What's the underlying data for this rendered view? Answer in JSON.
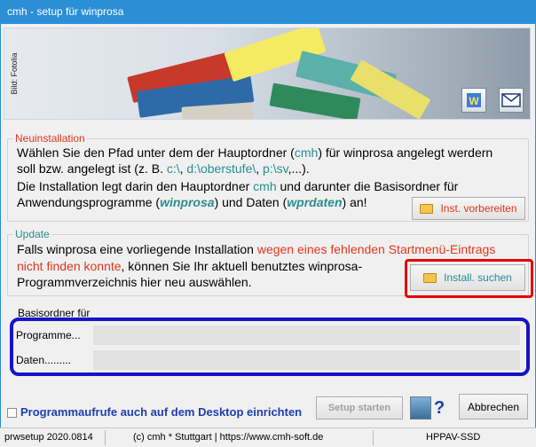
{
  "window": {
    "title": "cmh - setup für winprosa"
  },
  "banner": {
    "photo_credit": "Bild: Fotolia"
  },
  "toolbar": {
    "word_icon": "word-document-icon",
    "mail_icon": "mail-envelope-icon"
  },
  "new_install": {
    "title": "Neuinstallation",
    "t1": "Wählen Sie den Pfad unter dem der Hauptordner (",
    "t1_cmh": "cmh",
    "t1b": ") für winprosa angelegt werdern",
    "t2": "soll bzw. angelegt ist (z. B.",
    "t2_c": "c:\\",
    "t2_comma1": ",",
    "t2_d": "d:\\oberstufe\\",
    "t2_comma2": ",",
    "t2_p": "p:\\sv",
    "t2_end": ",...).",
    "t3": "Die Installation legt darin den Hauptordner",
    "t3_cmh": "cmh",
    "t3b": "und darunter die Basisordner für",
    "t4": "Anwendungsprogramme (",
    "t4_winprosa": "winprosa",
    "t4b": ") und Daten  (",
    "t4_wprdaten": "wprdaten",
    "t4c": ") an!",
    "button": "Inst. vorbereiten"
  },
  "update": {
    "title": "Update",
    "l1": "Falls winprosa eine vorliegende Installation",
    "l1_red": "wegen eines fehlenden Startmenü-Eintrags",
    "l2_red": "nicht finden konnte",
    "l2": ", können Sie Ihr aktuell benutztes winprosa-",
    "l3": "Programmverzeichnis hier neu auswählen.",
    "button": "Install. suchen"
  },
  "basis": {
    "title": "Basisordner für",
    "program_label": "Programme...",
    "program_value": "",
    "data_label": "Daten.........",
    "data_value": ""
  },
  "bottom": {
    "desktop_checkbox_label": "Programmaufrufe auch auf dem Desktop einrichten",
    "desktop_checked": false,
    "setup_button": "Setup starten",
    "help_mark": "?",
    "cancel_button": "Abbrechen"
  },
  "status": {
    "version": "prwsetup 2020.0814",
    "copyright": "(c) cmh * Stuttgart | https://www.cmh-soft.de",
    "machine": "HPPAV-SSD"
  },
  "colors": {
    "title_bar": "#2b8fd6",
    "accent_red": "#e2361b",
    "accent_teal": "#2a8c91",
    "highlight_blue": "#1414c8",
    "highlight_red": "#e80000"
  }
}
